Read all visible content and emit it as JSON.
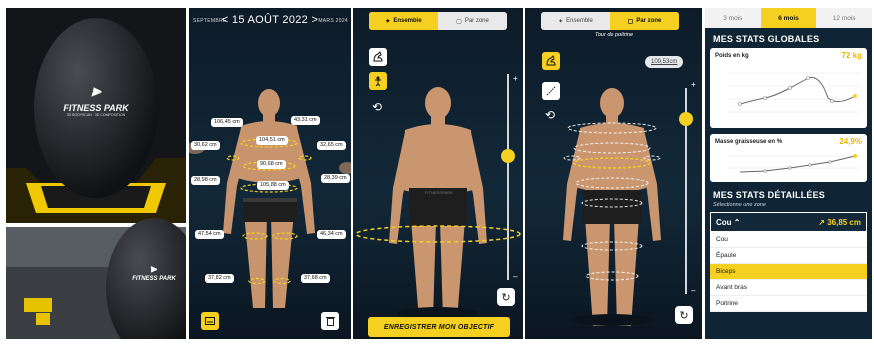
{
  "photo": {
    "brand_text": "FITNESS PARK",
    "brand_sub": "3D BODYSCAN · 3D COMPOSITION"
  },
  "screen2": {
    "prev_month": "SEPTEMBRE",
    "date_label": "15 AOÛT 2022",
    "next_month": "MARS 2024",
    "measurements": [
      "106,45 cm",
      "43,31 cm",
      "104,51 cm",
      "30,62 cm",
      "32,65 cm",
      "90,68 cm",
      "28,98 cm",
      "28,39 cm",
      "105,88 cm",
      "47,54 cm",
      "46,34 cm",
      "37,82 cm",
      "37,68 cm"
    ]
  },
  "screen3": {
    "toggle_all": "Ensemble",
    "toggle_zone": "Par zone",
    "save_goal": "ENREGISTRER MON OBJECTIF",
    "slider_level_pct": 40
  },
  "screen4": {
    "toggle_all": "Ensemble",
    "toggle_zone": "Par zone",
    "zone_caption": "Tour de poitrine",
    "value_chip": "109,53cm",
    "slider_level_pct": 15
  },
  "stats": {
    "tabs": [
      "3 mois",
      "6 mois",
      "12 mois"
    ],
    "active_tab": 1,
    "global_title": "MES STATS GLOBALES",
    "weight_label": "Poids en kg",
    "weight_value": "72 kg",
    "fat_label": "Masse graisseuse en %",
    "fat_value": "24,9%",
    "detail_title": "MES STATS DÉTAILLÉES",
    "detail_sub": "Sélectionne une zone",
    "zone_selected": "Cou",
    "zone_value": "↗ 36,85 cm",
    "zones": [
      "Cou",
      "Épaule",
      "Biceps",
      "Avant bras",
      "Poitrine"
    ],
    "selected_zone_index": 2
  },
  "colors": {
    "accent": "#f5d021",
    "panel_bg": "#0f2434"
  }
}
